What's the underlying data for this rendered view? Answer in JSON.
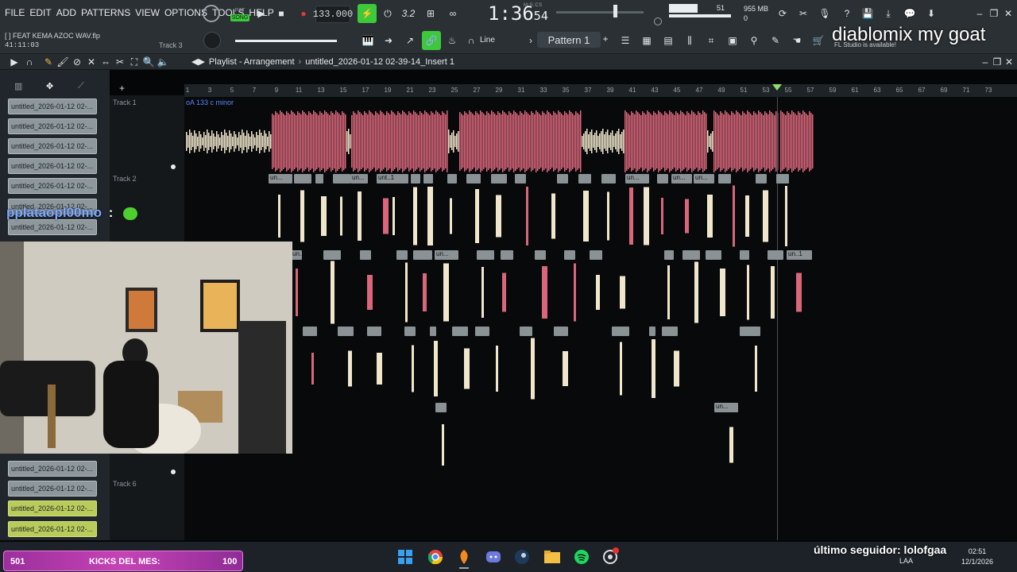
{
  "menu": [
    "FILE",
    "EDIT",
    "ADD",
    "PATTERNS",
    "VIEW",
    "OPTIONS",
    "TOOLS",
    "HELP"
  ],
  "transport": {
    "mode_top": "PAT",
    "mode_bottom": "SONG",
    "tempo": "133.000",
    "time_main": "1:36",
    "time_small": "54",
    "time_unit": "M:S:CS"
  },
  "memory": {
    "cpu_value": "51",
    "ram": "955 MB",
    "polyphony": "0"
  },
  "project": {
    "file_name": "[ ] FEAT KEMA AZOC WAV.flp",
    "elapsed": "41:11:03",
    "track_label": "Track 3"
  },
  "toolbar": {
    "snap": "Line",
    "pattern": "Pattern 1"
  },
  "news": "FL Studio is available!",
  "stream_overlay": {
    "title": "diablomix my goat"
  },
  "playlist": {
    "breadcrumb_1": "Playlist - Arrangement",
    "breadcrumb_2": "untitled_2026-01-12 02-39-14_Insert 1"
  },
  "clips": {
    "items": [
      "untitled_2026-01-12 02-...",
      "untitled_2026-01-12 02-...",
      "untitled_2026-01-12 02-...",
      "untitled_2026-01-12 02-...",
      "untitled_2026-01-12 02-...",
      "untitled_2026-01-12 02-...",
      "untitled_2026-01-12 02-...",
      "untitled_2026-01-12 02-...",
      "untitled_2026-01-12 02-...",
      "untitled_2026-01-12 02-...",
      "untitled_2026-01-12 02-..."
    ]
  },
  "tracks": [
    "Track 1",
    "Track 2",
    "Track 6"
  ],
  "track1_marker": "oA 133 c minor",
  "ruler": [
    "1",
    "3",
    "5",
    "7",
    "9",
    "11",
    "13",
    "15",
    "17",
    "19",
    "21",
    "23",
    "25",
    "27",
    "29",
    "31",
    "33",
    "35",
    "37",
    "39",
    "41",
    "43",
    "45",
    "47",
    "49",
    "51",
    "53",
    "55",
    "57",
    "59",
    "61",
    "63",
    "65",
    "67",
    "69",
    "71",
    "73"
  ],
  "clip_labels": {
    "un": "un...",
    "unt": "unt..1",
    "un1": "un..1",
    "un2": "un..."
  },
  "chat": {
    "user": "pplataopl00mo",
    "sep": ":"
  },
  "kicks": {
    "left": "501",
    "label": "KICKS DEL MES:",
    "right": "100"
  },
  "follower": "último seguidor: lolofgaa",
  "tray": {
    "lang": "LAA",
    "time": "02:51",
    "date": "12/1/2026"
  },
  "colors": {
    "accent": "#3cc93c",
    "waveform_pink": "#d9667b",
    "waveform_cream": "#f0e6cc"
  }
}
